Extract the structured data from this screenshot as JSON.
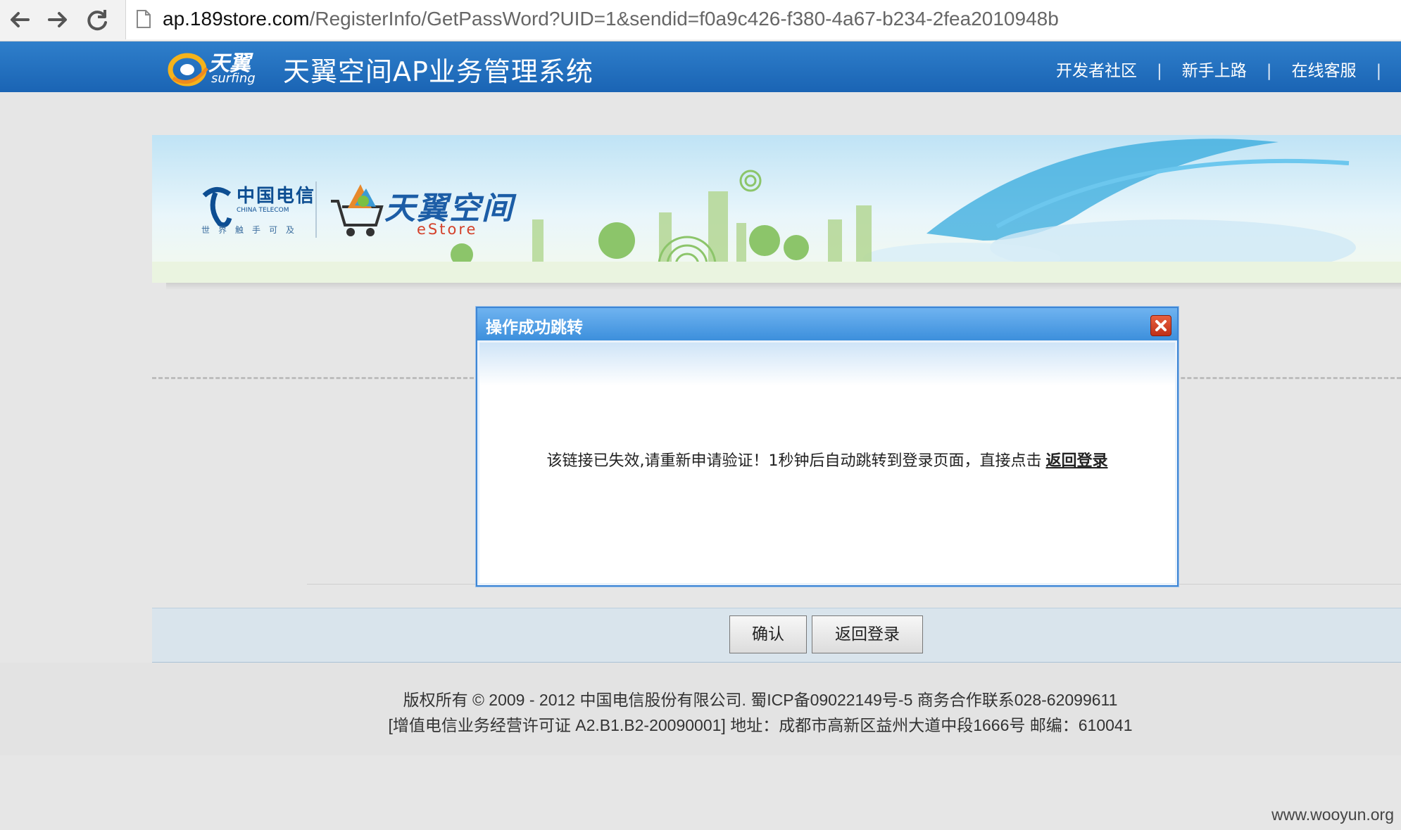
{
  "browser": {
    "url_host": "ap.189store.com",
    "url_path": "/RegisterInfo/GetPassWord?UID=1&sendid=f0a9c426-f380-4a67-b234-2fea2010948b",
    "icons": [
      "back-arrow-icon",
      "forward-arrow-icon",
      "reload-icon",
      "page-icon"
    ]
  },
  "header": {
    "logo_text": "天翼",
    "logo_sub": "surfing",
    "title": "天翼空间AP业务管理系统",
    "links": [
      "开发者社区",
      "新手上路",
      "在线客服"
    ],
    "separator": "|",
    "bg_color": "#1a64b4"
  },
  "banner": {
    "ct_cn": "中国电信",
    "ct_en": "CHINA TELECOM",
    "ct_slogan": "世界触手可及",
    "estore_title": "天翼空间",
    "estore_sub": "eStore"
  },
  "dialog": {
    "title": "操作成功跳转",
    "message": "该链接已失效,请重新申请验证！1秒钟后自动跳转到登录页面，直接点击",
    "link": "返回登录",
    "close_icon": "close-icon"
  },
  "buttons": {
    "confirm": "确认",
    "return": "返回登录"
  },
  "footer": {
    "line1": "版权所有 © 2009 - 2012 中国电信股份有限公司. 蜀ICP备09022149号-5 商务合作联系028-62099611",
    "line2": "[增值电信业务经营许可证 A2.B1.B2-20090001] 地址：成都市高新区益州大道中段1666号 邮编：610041"
  },
  "watermark": "www.wooyun.org"
}
